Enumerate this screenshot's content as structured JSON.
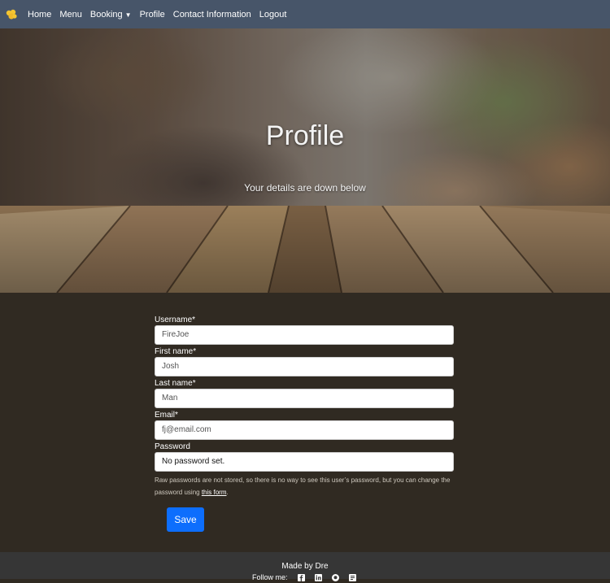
{
  "nav": {
    "items": [
      {
        "label": "Home"
      },
      {
        "label": "Menu"
      },
      {
        "label": "Booking"
      },
      {
        "label": "Profile"
      },
      {
        "label": "Contact Information"
      },
      {
        "label": "Logout"
      }
    ]
  },
  "hero": {
    "title": "Profile",
    "subtitle": "Your details are down below"
  },
  "form": {
    "username_label": "Username*",
    "username_value": "FireJoe",
    "firstname_label": "First name*",
    "firstname_value": "Josh",
    "lastname_label": "Last name*",
    "lastname_value": "Man",
    "email_label": "Email*",
    "email_value": "fj@email.com",
    "password_label": "Password",
    "password_value": "No password set.",
    "help_text_before": "Raw passwords are not stored, so there is no way to see this user’s password, but you can change the password using ",
    "help_link": "this form",
    "help_text_after": ".",
    "save_label": "Save"
  },
  "footer": {
    "made_by": "Made by Dre",
    "follow": "Follow me:"
  },
  "colors": {
    "navbar": "#475569",
    "page_background": "#302a22",
    "button": "#0d6efd",
    "footer": "#363636"
  }
}
